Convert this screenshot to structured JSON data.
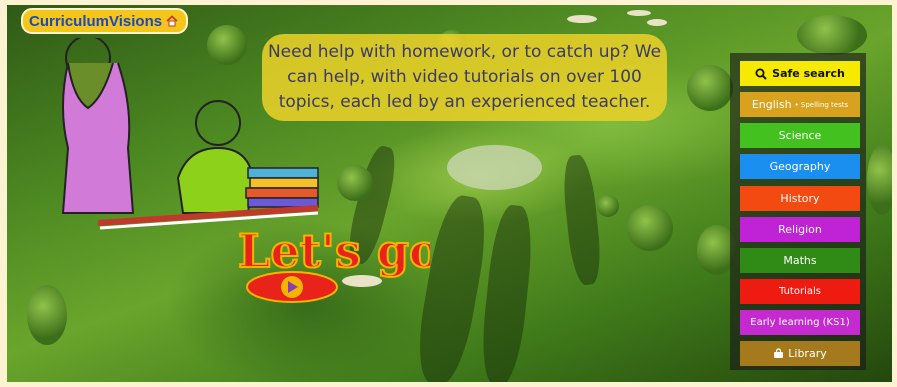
{
  "logo": {
    "text": "CurriculumVisions",
    "icon": "house-icon"
  },
  "banner": {
    "text": "Need help with homework, or to catch up? We can help, with video tutorials on over 100 topics, each led by an experienced teacher."
  },
  "cta": {
    "text": "Let's go",
    "icon": "play-icon"
  },
  "nav": {
    "safe_search": {
      "label": "Safe search",
      "icon": "search-icon",
      "color": "#f5ea00",
      "text_color": "#111111"
    },
    "english": {
      "label": "English",
      "sub": "Spelling tests",
      "color": "#d8a21e"
    },
    "science": {
      "label": "Science",
      "color": "#43c11e"
    },
    "geography": {
      "label": "Geography",
      "color": "#1b8ff0"
    },
    "history": {
      "label": "History",
      "color": "#f24a10"
    },
    "religion": {
      "label": "Religion",
      "color": "#c022d6"
    },
    "maths": {
      "label": "Maths",
      "color": "#2f8a16"
    },
    "tutorials": {
      "label": "Tutorials",
      "color": "#ee1c10"
    },
    "early_learning": {
      "label": "Early learning (KS1)",
      "color": "#c42ad0"
    },
    "library": {
      "label": "Library",
      "icon": "bag-icon",
      "color": "#a57a1c"
    }
  }
}
